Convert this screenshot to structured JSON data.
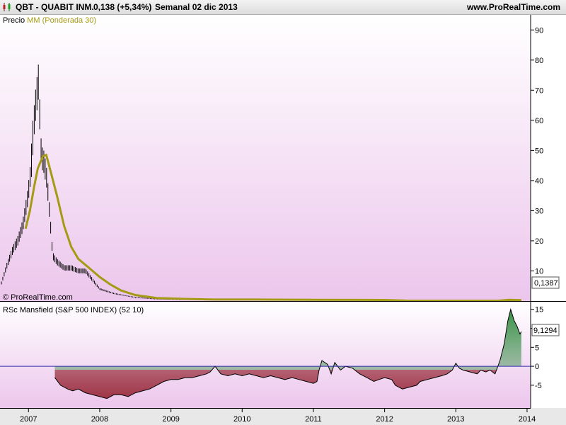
{
  "header": {
    "ticker": "QBT - QUABIT INM.",
    "price_change": "0,138 (+5,34%)",
    "period": "Semanal  02 dic 2013",
    "site": "www.ProRealTime.com"
  },
  "colors": {
    "ma_line": "#a49a14",
    "price_bar": "#000000",
    "zero_line": "#2a2aa8",
    "fill_negative": "#9a2e3e",
    "fill_positive": "#2f8a3e",
    "panel_top": "#ffffff",
    "panel_bottom": "#ecc6ec"
  },
  "chart_data": [
    {
      "type": "line",
      "legend": {
        "prefix": "Precio",
        "ma_label": "MM (Ponderada 30)",
        "placement": "top-left"
      },
      "copyright": "© ProRealTime.com",
      "last_value_label": "0,1387",
      "y_ticks": [
        10,
        20,
        30,
        40,
        50,
        60,
        70,
        80,
        90
      ],
      "ylim": [
        0,
        95
      ],
      "xlim": [
        2006.6,
        2014.05
      ],
      "x_ticks": [
        "2007",
        "2008",
        "2009",
        "2010",
        "2011",
        "2012",
        "2013",
        "2014"
      ],
      "price_points": [
        [
          2006.62,
          6
        ],
        [
          2006.7,
          12
        ],
        [
          2006.78,
          17
        ],
        [
          2006.85,
          20
        ],
        [
          2006.92,
          25
        ],
        [
          2006.98,
          33
        ],
        [
          2007.02,
          40
        ],
        [
          2007.06,
          55
        ],
        [
          2007.1,
          65
        ],
        [
          2007.14,
          73
        ],
        [
          2007.18,
          48
        ],
        [
          2007.22,
          46
        ],
        [
          2007.26,
          40
        ],
        [
          2007.3,
          28
        ],
        [
          2007.34,
          15
        ],
        [
          2007.4,
          13
        ],
        [
          2007.5,
          11
        ],
        [
          2007.6,
          11
        ],
        [
          2007.7,
          10
        ],
        [
          2007.8,
          10
        ],
        [
          2007.9,
          7
        ],
        [
          2008.0,
          4
        ],
        [
          2008.2,
          2.5
        ],
        [
          2008.5,
          1.2
        ],
        [
          2008.8,
          0.7
        ],
        [
          2009.2,
          0.5
        ],
        [
          2010.0,
          0.4
        ],
        [
          2011.0,
          0.3
        ],
        [
          2012.0,
          0.25
        ],
        [
          2012.5,
          0.14
        ],
        [
          2013.0,
          0.1
        ],
        [
          2013.6,
          0.12
        ],
        [
          2013.92,
          0.138
        ]
      ],
      "ma_points": [
        [
          2006.96,
          24
        ],
        [
          2007.02,
          30
        ],
        [
          2007.08,
          38
        ],
        [
          2007.13,
          44
        ],
        [
          2007.2,
          48
        ],
        [
          2007.25,
          48.5
        ],
        [
          2007.3,
          44
        ],
        [
          2007.4,
          35
        ],
        [
          2007.5,
          25
        ],
        [
          2007.6,
          18
        ],
        [
          2007.7,
          14
        ],
        [
          2007.85,
          11
        ],
        [
          2008.0,
          8
        ],
        [
          2008.15,
          5.5
        ],
        [
          2008.3,
          3.5
        ],
        [
          2008.5,
          2
        ],
        [
          2008.8,
          1
        ],
        [
          2009.2,
          0.7
        ],
        [
          2009.6,
          0.5
        ],
        [
          2010.2,
          0.5
        ],
        [
          2011.0,
          0.4
        ],
        [
          2012.0,
          0.35
        ],
        [
          2012.3,
          0.15
        ],
        [
          2013.0,
          0.12
        ],
        [
          2013.6,
          0.12
        ],
        [
          2013.75,
          0.4
        ],
        [
          2013.92,
          0.3
        ]
      ]
    },
    {
      "type": "area",
      "title": "RSc Mansfield (S&P 500 INDEX) (52 10)",
      "last_value_label": "9,1294",
      "y_ticks": [
        -5,
        0,
        5,
        10,
        15
      ],
      "ylim": [
        -11,
        17
      ],
      "xlim": [
        2006.6,
        2014.05
      ],
      "points": [
        [
          2007.37,
          -3
        ],
        [
          2007.45,
          -5
        ],
        [
          2007.55,
          -6
        ],
        [
          2007.62,
          -6.5
        ],
        [
          2007.7,
          -6
        ],
        [
          2007.8,
          -7
        ],
        [
          2007.9,
          -7.5
        ],
        [
          2008.0,
          -8
        ],
        [
          2008.1,
          -8.5
        ],
        [
          2008.2,
          -7.5
        ],
        [
          2008.3,
          -7.5
        ],
        [
          2008.4,
          -8
        ],
        [
          2008.5,
          -7
        ],
        [
          2008.6,
          -6.5
        ],
        [
          2008.7,
          -6
        ],
        [
          2008.8,
          -5
        ],
        [
          2008.9,
          -4
        ],
        [
          2009.0,
          -3.5
        ],
        [
          2009.1,
          -3.5
        ],
        [
          2009.2,
          -3
        ],
        [
          2009.3,
          -3
        ],
        [
          2009.4,
          -2.5
        ],
        [
          2009.5,
          -2
        ],
        [
          2009.55,
          -1.5
        ],
        [
          2009.62,
          0
        ],
        [
          2009.7,
          -2
        ],
        [
          2009.8,
          -2.5
        ],
        [
          2009.9,
          -2
        ],
        [
          2010.0,
          -2.5
        ],
        [
          2010.1,
          -2
        ],
        [
          2010.2,
          -2.5
        ],
        [
          2010.3,
          -3
        ],
        [
          2010.4,
          -2.5
        ],
        [
          2010.5,
          -3
        ],
        [
          2010.6,
          -3.5
        ],
        [
          2010.7,
          -3
        ],
        [
          2010.8,
          -3.5
        ],
        [
          2010.9,
          -4
        ],
        [
          2011.0,
          -4.5
        ],
        [
          2011.05,
          -4
        ],
        [
          2011.08,
          -1
        ],
        [
          2011.12,
          1.5
        ],
        [
          2011.2,
          0.5
        ],
        [
          2011.25,
          -2
        ],
        [
          2011.3,
          1
        ],
        [
          2011.38,
          -1
        ],
        [
          2011.45,
          0
        ],
        [
          2011.55,
          -0.5
        ],
        [
          2011.65,
          -2
        ],
        [
          2011.75,
          -3
        ],
        [
          2011.85,
          -4
        ],
        [
          2011.92,
          -3.5
        ],
        [
          2012.0,
          -3
        ],
        [
          2012.1,
          -3.5
        ],
        [
          2012.15,
          -5
        ],
        [
          2012.25,
          -6
        ],
        [
          2012.35,
          -5.5
        ],
        [
          2012.45,
          -5
        ],
        [
          2012.5,
          -4
        ],
        [
          2012.6,
          -3.5
        ],
        [
          2012.7,
          -3
        ],
        [
          2012.8,
          -2.5
        ],
        [
          2012.88,
          -2
        ],
        [
          2012.95,
          -1
        ],
        [
          2013.0,
          0.8
        ],
        [
          2013.05,
          -0.5
        ],
        [
          2013.1,
          -1
        ],
        [
          2013.2,
          -1.5
        ],
        [
          2013.3,
          -2
        ],
        [
          2013.35,
          -1
        ],
        [
          2013.42,
          -1.5
        ],
        [
          2013.48,
          -1
        ],
        [
          2013.55,
          -2
        ],
        [
          2013.62,
          1.5
        ],
        [
          2013.68,
          6
        ],
        [
          2013.73,
          12
        ],
        [
          2013.77,
          15
        ],
        [
          2013.82,
          12
        ],
        [
          2013.86,
          10.5
        ],
        [
          2013.9,
          8.5
        ],
        [
          2013.92,
          9.13
        ]
      ]
    }
  ]
}
